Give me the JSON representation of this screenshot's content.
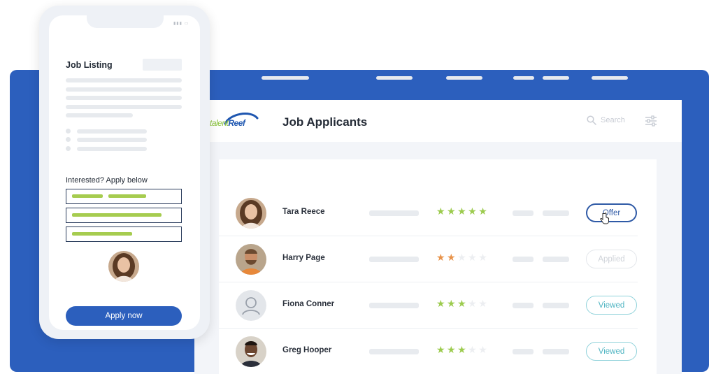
{
  "desktop": {
    "logo": {
      "part1": "talent",
      "part2": "Reef"
    },
    "title": "Job Applicants",
    "search": {
      "placeholder": "Search",
      "icon": "search-icon"
    },
    "filter_icon": "sliders-icon",
    "applicants": [
      {
        "name": "Tara Reece",
        "rating": 5,
        "max_rating": 5,
        "status": "Offer"
      },
      {
        "name": "Harry Page",
        "rating": 2,
        "max_rating": 5,
        "status": "Applied"
      },
      {
        "name": "Fiona Conner",
        "rating": 3,
        "max_rating": 5,
        "status": "Viewed"
      },
      {
        "name": "Greg Hooper",
        "rating": 3,
        "max_rating": 5,
        "status": "Viewed"
      }
    ]
  },
  "phone": {
    "title": "Job Listing",
    "apply_prompt": "Interested? Apply below",
    "apply_button": "Apply now"
  },
  "colors": {
    "brand_blue": "#2c5fbd",
    "star_green": "#9ccb4e",
    "star_orange": "#e8934a",
    "offer_blue": "#2f5aa6",
    "viewed_teal": "#4eb4c2",
    "field_fill_green": "#a6cc4f"
  }
}
